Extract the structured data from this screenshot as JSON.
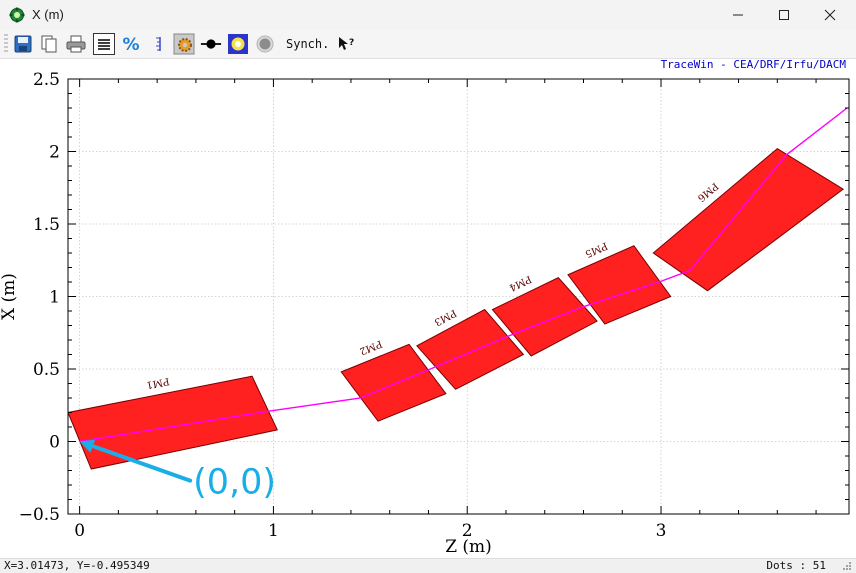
{
  "window": {
    "title": "X (m)"
  },
  "toolbar": {
    "synch_label": "Synch."
  },
  "status": {
    "coords": "X=3.01473, Y=-0.495349",
    "dots": "Dots : 51"
  },
  "chart_data": {
    "type": "line",
    "title": "",
    "credit": "TraceWin - CEA/DRF/Irfu/DACM",
    "xlabel": "Z (m)",
    "ylabel": "X (m)",
    "xlim": [
      -0.06,
      3.97
    ],
    "ylim": [
      -0.5,
      2.5
    ],
    "x_ticks": [
      0,
      1,
      2,
      3
    ],
    "x_tick_labels": [
      "0",
      "1",
      "2",
      "3"
    ],
    "y_ticks": [
      -0.5,
      0,
      0.5,
      1,
      1.5,
      2,
      2.5
    ],
    "y_tick_labels": [
      "−0.5",
      "0",
      "0.5",
      "1",
      "1.5",
      "2",
      "2.5"
    ],
    "grid": true,
    "series": [
      {
        "name": "",
        "color": "#ff00ff",
        "x": [
          0,
          0.98,
          1.45,
          1.81,
          2.2,
          2.6,
          2.99,
          3.15,
          3.65,
          3.96
        ],
        "y": [
          0,
          0.21,
          0.3,
          0.5,
          0.72,
          0.93,
          1.1,
          1.18,
          1.98,
          2.3
        ]
      }
    ],
    "elements": [
      {
        "label": "PM1",
        "color": "#ff2020",
        "corners": [
          [
            -0.06,
            0.2
          ],
          [
            0.89,
            0.45
          ],
          [
            1.02,
            0.08
          ],
          [
            0.06,
            -0.19
          ]
        ]
      },
      {
        "label": "PM2",
        "color": "#ff2020",
        "corners": [
          [
            1.35,
            0.48
          ],
          [
            1.7,
            0.67
          ],
          [
            1.89,
            0.33
          ],
          [
            1.54,
            0.14
          ]
        ]
      },
      {
        "label": "PM3",
        "color": "#ff2020",
        "corners": [
          [
            1.74,
            0.66
          ],
          [
            2.09,
            0.91
          ],
          [
            2.29,
            0.6
          ],
          [
            1.94,
            0.36
          ]
        ]
      },
      {
        "label": "PM4",
        "color": "#ff2020",
        "corners": [
          [
            2.13,
            0.91
          ],
          [
            2.47,
            1.13
          ],
          [
            2.67,
            0.83
          ],
          [
            2.33,
            0.59
          ]
        ]
      },
      {
        "label": "PM5",
        "color": "#ff2020",
        "corners": [
          [
            2.52,
            1.15
          ],
          [
            2.86,
            1.35
          ],
          [
            3.05,
            1.0
          ],
          [
            2.71,
            0.81
          ]
        ]
      },
      {
        "label": "PM6",
        "color": "#ff2020",
        "corners": [
          [
            2.96,
            1.3
          ],
          [
            3.6,
            2.02
          ],
          [
            3.94,
            1.74
          ],
          [
            3.24,
            1.04
          ]
        ]
      }
    ],
    "annotation": {
      "text": "(0,0)",
      "color": "#19aee8",
      "from": [
        0.57,
        -0.27
      ],
      "to": [
        0,
        0
      ]
    }
  }
}
